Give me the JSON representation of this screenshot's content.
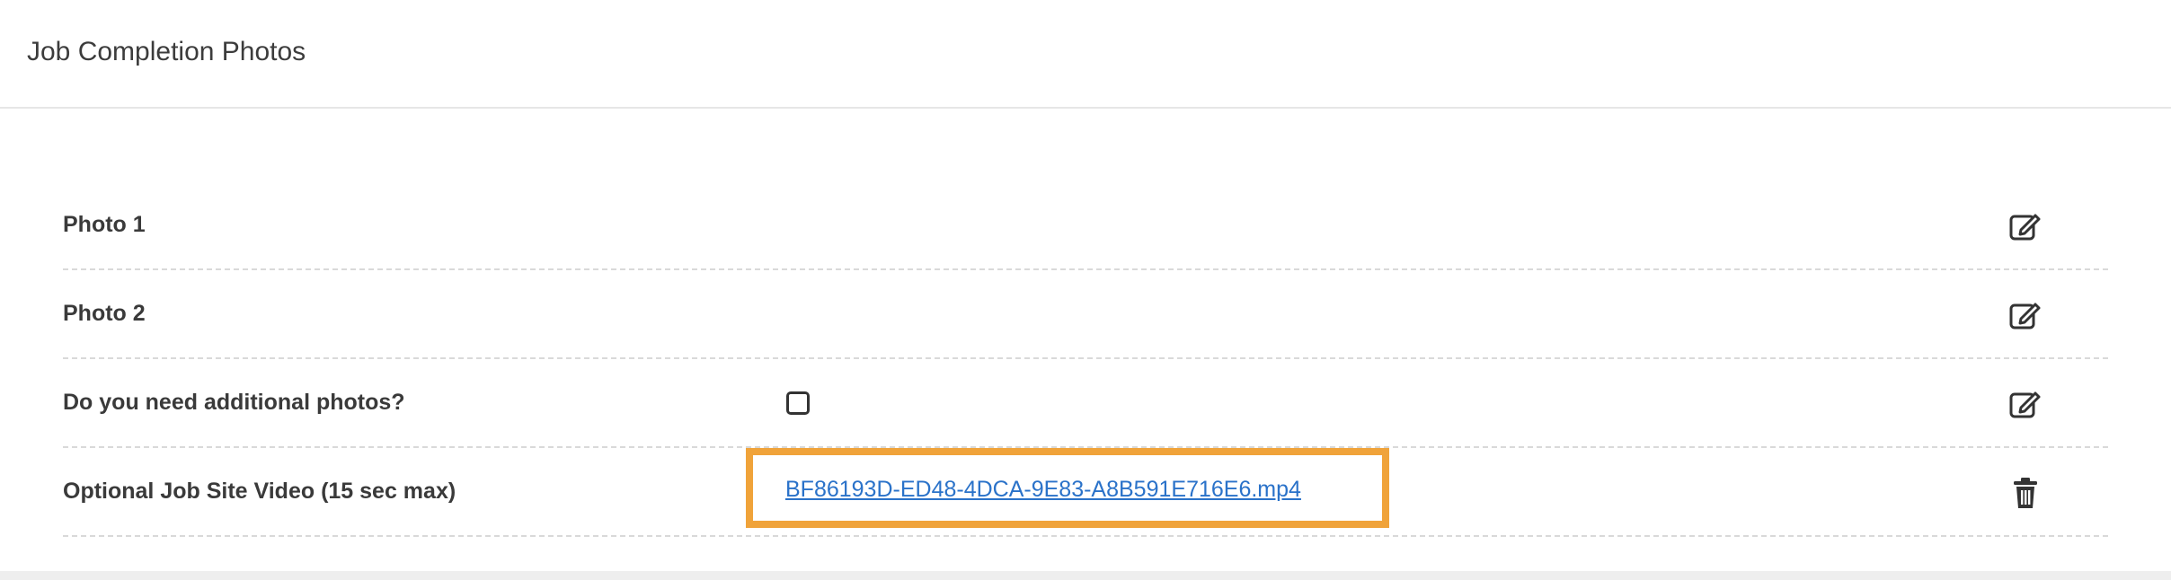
{
  "header": {
    "title": "Job Completion Photos"
  },
  "rows": [
    {
      "label": "Photo 1",
      "action_icon": "edit-icon"
    },
    {
      "label": "Photo 2",
      "action_icon": "edit-icon"
    },
    {
      "label": "Do you need additional photos?",
      "checkbox_checked": false,
      "action_icon": "edit-icon"
    },
    {
      "label": "Optional Job Site Video (15 sec max)",
      "file_link": "BF86193D-ED48-4DCA-9E83-A8B591E716E6.mp4",
      "action_icon": "trash-icon"
    }
  ],
  "colors": {
    "highlight": "#f0a33a",
    "link": "#2a72c9",
    "text": "#3a3a3a"
  }
}
